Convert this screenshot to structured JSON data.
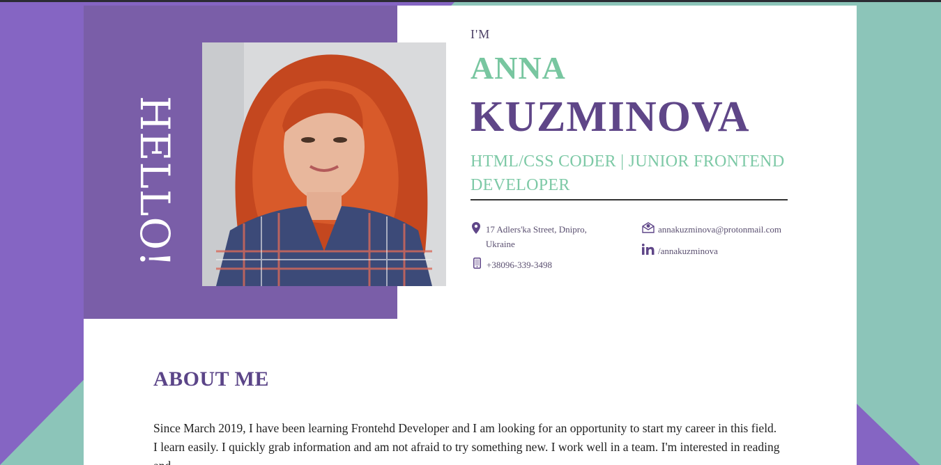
{
  "hero": {
    "hello": "HELLO!",
    "im_label": "I'M",
    "first_name": "ANNA",
    "last_name": "KUZMINOVA",
    "role": "HTML/CSS CODER | JUNIOR FRONTEND DEVELOPER"
  },
  "contacts": {
    "address": "17 Adlers'ka Street, Dnipro, Ukraine",
    "phone": "+38096-339-3498",
    "email": "annakuzminova@protonmail.com",
    "linkedin": "/annakuzminova"
  },
  "about": {
    "title": "ABOUT ME",
    "text": "Since March 2019, I have been learning Frontehd Developer and I am looking for an opportunity to start my career in this field. I learn easily. I quickly grab information and am not afraid to try something new. I work well in a team. I'm interested in reading and"
  },
  "icons": {
    "address": "map-pin-icon",
    "phone": "phone-icon",
    "email": "envelope-icon",
    "linkedin": "linkedin-icon"
  },
  "colors": {
    "purple_bg": "#8565c3",
    "teal_bg": "#8cc5b9",
    "panel_purple": "#7a5ea8",
    "name_purple": "#5f4688",
    "accent_green": "#78c6a0"
  }
}
